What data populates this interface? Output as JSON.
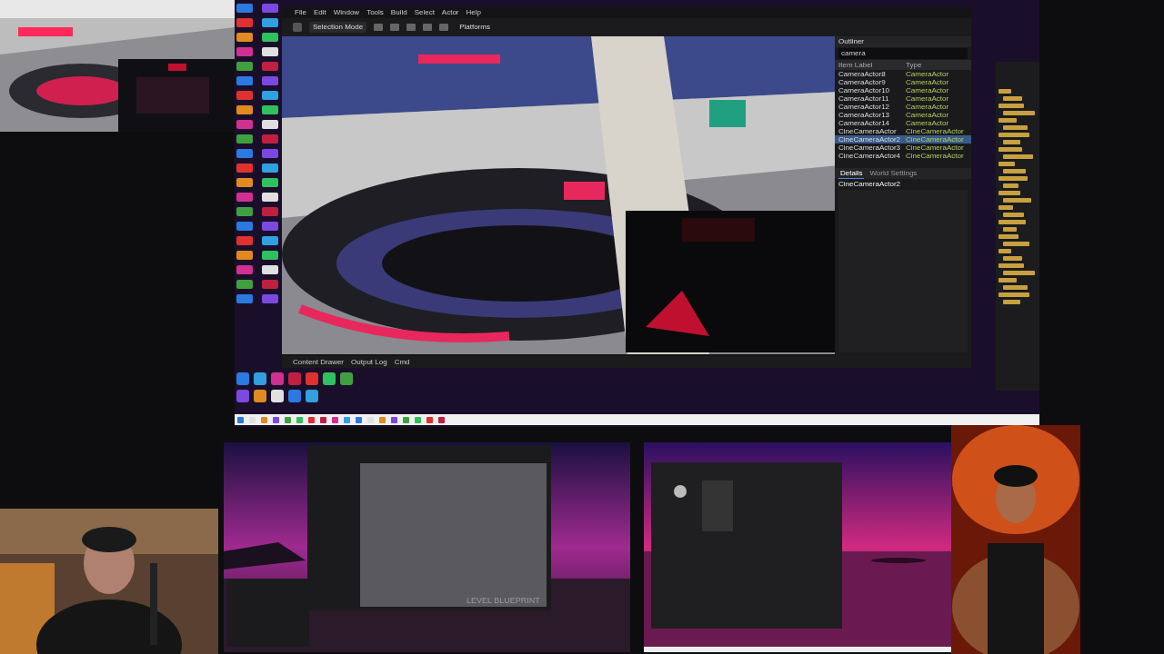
{
  "main_capture": {
    "editor": {
      "menu": [
        "File",
        "Edit",
        "Window",
        "Tools",
        "Build",
        "Select",
        "Actor",
        "Help"
      ],
      "toolbar": {
        "mode": "Selection Mode",
        "platforms": "Platforms"
      },
      "outliner": {
        "title": "Outliner",
        "search": "camera",
        "columns": [
          "Item Label",
          "Type"
        ],
        "rows": [
          {
            "label": "CameraActor8",
            "type": "CameraActor",
            "selected": false
          },
          {
            "label": "CameraActor9",
            "type": "CameraActor",
            "selected": false
          },
          {
            "label": "CameraActor10",
            "type": "CameraActor",
            "selected": false
          },
          {
            "label": "CameraActor11",
            "type": "CameraActor",
            "selected": false
          },
          {
            "label": "CameraActor12",
            "type": "CameraActor",
            "selected": false
          },
          {
            "label": "CameraActor13",
            "type": "CameraActor",
            "selected": false
          },
          {
            "label": "CameraActor14",
            "type": "CameraActor",
            "selected": false
          },
          {
            "label": "CineCameraActor",
            "type": "CineCameraActor",
            "selected": false
          },
          {
            "label": "CineCameraActor2",
            "type": "CineCameraActor",
            "selected": true
          },
          {
            "label": "CineCameraActor3",
            "type": "CineCameraActor",
            "selected": false
          },
          {
            "label": "CineCameraActor4",
            "type": "CineCameraActor",
            "selected": false
          }
        ]
      },
      "details": {
        "tabs": [
          {
            "label": "Details",
            "selected": true
          },
          {
            "label": "World Settings",
            "selected": false
          }
        ],
        "actor": "CineCameraActor2"
      },
      "bottom_bar": [
        "Content Drawer",
        "Output Log",
        "Cmd"
      ]
    }
  },
  "blueprint_capture": {
    "watermark": "LEVEL BLUEPRINT"
  }
}
